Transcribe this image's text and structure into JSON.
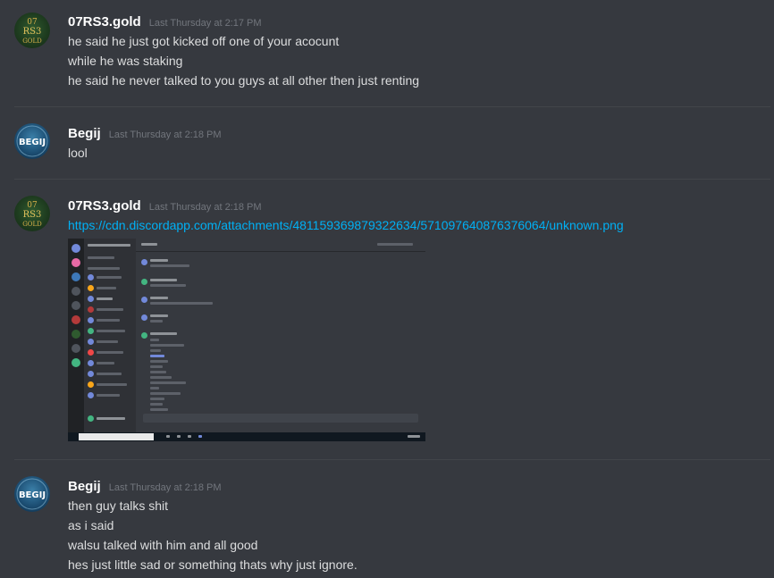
{
  "messages": [
    {
      "username": "07RS3.gold",
      "timestamp": "Last Thursday at 2:17 PM",
      "lines": [
        "he said he just got kicked off one of your acocunt",
        "while he was staking",
        "he said he never talked to you guys at all other then just renting"
      ]
    },
    {
      "username": "Begij",
      "timestamp": "Last Thursday at 2:18 PM",
      "lines": [
        "lool"
      ]
    },
    {
      "username": "07RS3.gold",
      "timestamp": "Last Thursday at 2:18 PM",
      "link": "https://cdn.discordapp.com/attachments/481159369879322634/571097640876376064/unknown.png"
    },
    {
      "username": "Begij",
      "timestamp": "Last Thursday at 2:18 PM",
      "lines": [
        "then guy talks shit",
        "as i said",
        "walsu talked with him and all good",
        "hes just little sad or something thats why just ignore."
      ]
    }
  ],
  "avatars": {
    "gold_text_lines": [
      "07",
      "RS3",
      "GOLD"
    ],
    "begij_text": "BEGIJ"
  },
  "colors": {
    "background": "#36393f",
    "username": "#ffffff",
    "timestamp": "#72767d",
    "text": "#dcddde",
    "link": "#00b0f4",
    "divider": "#42454a"
  }
}
